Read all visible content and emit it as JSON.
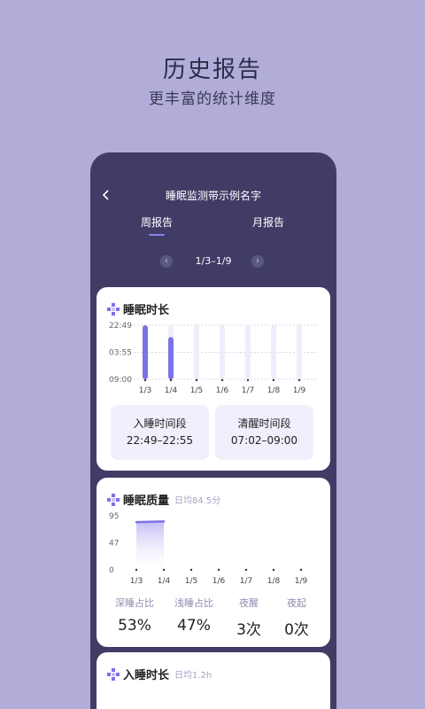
{
  "promo": {
    "title": "历史报告",
    "subtitle": "更丰富的统计维度"
  },
  "header": {
    "title": "睡眠监测带示例名字"
  },
  "tabs": [
    {
      "label": "周报告",
      "active": true
    },
    {
      "label": "月报告",
      "active": false
    }
  ],
  "date_nav": {
    "range": "1/3–1/9",
    "prev_icon": "‹",
    "next_icon": "›"
  },
  "sleep_duration": {
    "title": "睡眠时长",
    "bedtime": {
      "label": "入睡时间段",
      "value": "22:49–22:55"
    },
    "wake": {
      "label": "清醒时间段",
      "value": "07:02–09:00"
    }
  },
  "sleep_quality": {
    "title": "睡眠质量",
    "subtitle": "日均84.5分",
    "stats": [
      {
        "label": "深睡占比",
        "value": "53%"
      },
      {
        "label": "浅睡占比",
        "value": "47%"
      },
      {
        "label": "夜醒",
        "value": "3次"
      },
      {
        "label": "夜起",
        "value": "0次"
      }
    ]
  },
  "sleep_onset": {
    "title": "入睡时长",
    "subtitle": "日均1.2h"
  },
  "colors": {
    "accent": "#7c72e6",
    "background": "#b1add8",
    "phone_bg": "#403c66"
  },
  "chart_data": [
    {
      "type": "bar",
      "title": "睡眠时长",
      "categories": [
        "1/3",
        "1/4",
        "1/5",
        "1/6",
        "1/7",
        "1/8",
        "1/9"
      ],
      "y_ticks": [
        "22:49",
        "03:55",
        "09:00"
      ],
      "ylim": [
        0,
        1
      ],
      "series": [
        {
          "ranges": [
            [
              0,
              1
            ],
            [
              0,
              0.78
            ],
            null,
            null,
            null,
            null,
            null
          ]
        }
      ]
    },
    {
      "type": "area",
      "title": "睡眠质量",
      "categories": [
        "1/3",
        "1/4",
        "1/5",
        "1/6",
        "1/7",
        "1/8",
        "1/9"
      ],
      "y_ticks": [
        "95",
        "47",
        "0"
      ],
      "ylim": [
        0,
        95
      ],
      "series": [
        {
          "values": [
            84,
            85,
            null,
            null,
            null,
            null,
            null
          ]
        }
      ]
    }
  ]
}
